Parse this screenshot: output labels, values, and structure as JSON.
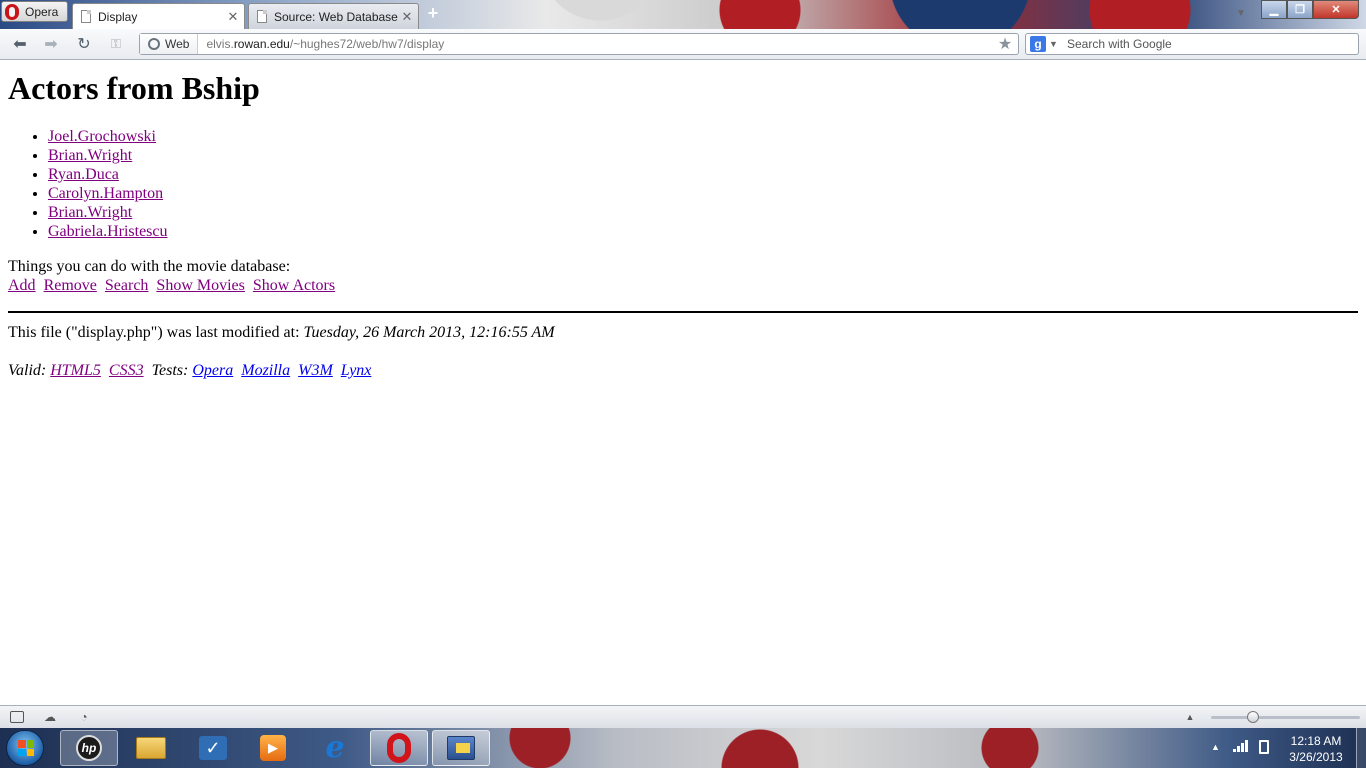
{
  "browser": {
    "menu_label": "Opera",
    "tabs": [
      {
        "label": "Display",
        "active": true
      },
      {
        "label": "Source: Web Database ...",
        "active": false
      }
    ],
    "address": {
      "badge": "Web",
      "url_prefix": "elvis.",
      "url_host": "rowan.edu",
      "url_path": "/~hughes72/web/hw7/display"
    },
    "search": {
      "engine_icon": "g",
      "placeholder": "Search with Google"
    }
  },
  "page": {
    "heading": "Actors from Bship",
    "actors": [
      "Joel.Grochowski",
      "Brian.Wright",
      "Ryan.Duca",
      "Carolyn.Hampton",
      "Brian.Wright",
      "Gabriela.Hristescu"
    ],
    "things_label": "Things you can do with the movie database:",
    "actions": [
      "Add",
      "Remove",
      "Search",
      "Show Movies",
      "Show Actors"
    ],
    "modified_prefix": "This file (\"display.php\") was last modified at: ",
    "modified_date": "Tuesday, 26 March 2013, 12:16:55 AM",
    "valid_label": "Valid:",
    "valid_links": [
      "HTML5",
      "CSS3"
    ],
    "tests_label": "Tests:",
    "test_links": [
      "Opera",
      "Mozilla",
      "W3M",
      "Lynx"
    ]
  },
  "taskbar": {
    "hp_label": "hp",
    "clock_time": "12:18 AM",
    "clock_date": "3/26/2013"
  },
  "colors": {
    "visited_link": "#800080",
    "unvisited_link": "#0000ee",
    "opera_red": "#d0141a"
  }
}
